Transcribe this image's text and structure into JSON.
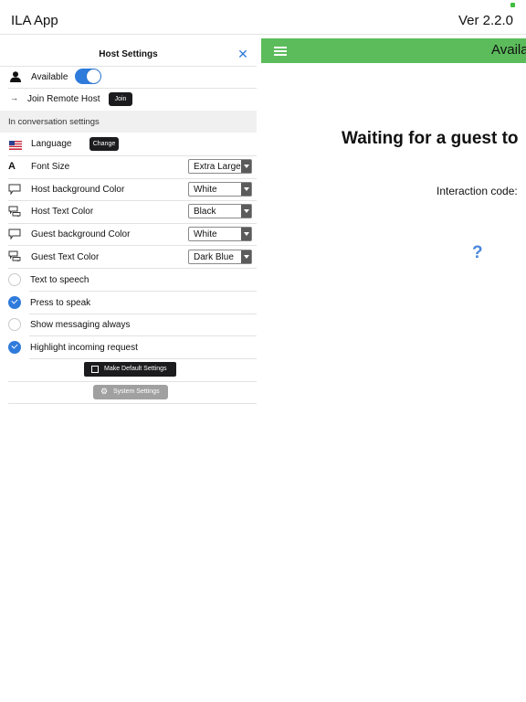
{
  "app": {
    "title": "ILA App",
    "version": "Ver 2.2.0"
  },
  "panel": {
    "title": "Host Settings",
    "close_icon": "close-icon",
    "available_label": "Available",
    "available_on": true,
    "remote_host_label": "Join Remote Host",
    "join_label": "Join",
    "section_header": "In conversation settings",
    "language_label": "Language",
    "change_label": "Change",
    "settings": [
      {
        "label": "Font Size",
        "value": "Extra Large",
        "icon": "font-size-icon"
      },
      {
        "label": "Host background Color",
        "value": "White",
        "icon": "speech-bubble-icon"
      },
      {
        "label": "Host Text Color",
        "value": "Black",
        "icon": "chat-bubbles-icon"
      },
      {
        "label": "Guest background Color",
        "value": "White",
        "icon": "speech-bubble-icon"
      },
      {
        "label": "Guest Text Color",
        "value": "Dark Blue",
        "icon": "chat-bubbles-icon"
      }
    ],
    "toggles": [
      {
        "label": "Text to speech",
        "checked": false
      },
      {
        "label": "Press to speak",
        "checked": true
      },
      {
        "label": "Show messaging always",
        "checked": false
      },
      {
        "label": "Highlight incoming request",
        "checked": true
      }
    ],
    "make_default_label": "Make Default Settings",
    "system_settings_label": "System Settings"
  },
  "main": {
    "status_title": "Availa",
    "waiting_text": "Waiting for a guest to",
    "interaction_label": "Interaction code:",
    "help_mark": "?"
  },
  "colors": {
    "accent": "#2f7bdc",
    "green_bar": "#5cbc5b",
    "battery": "#3fbf3f"
  }
}
